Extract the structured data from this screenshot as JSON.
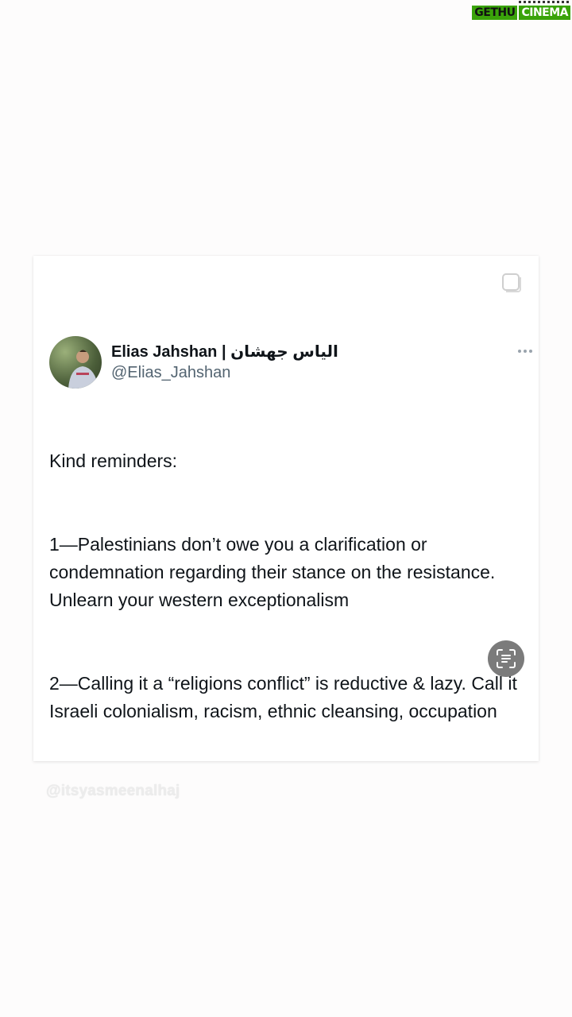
{
  "logo": {
    "part1": "GETHU",
    "part2": "CINEMA"
  },
  "tweet": {
    "author_name": "Elias Jahshan | الياس جهشان",
    "author_handle": "@Elias_Jahshan",
    "paragraphs": [
      "Kind reminders:",
      "1—Palestinians don’t owe you a clarification or condemnation regarding their stance on the resistance. Unlearn your western exceptionalism",
      "2—Calling it a “religions conflict” is reductive & lazy. Call it Israeli colonialism, racism, ethnic cleansing, occupation"
    ]
  },
  "watermark": "@itsyasmeenalhaj",
  "icons": {
    "copy": "copy-icon",
    "more": "more-options-icon",
    "scan": "text-scan-icon"
  },
  "colors": {
    "logo_green": "#3aa30a",
    "handle_gray": "#536471",
    "scan_button": "#7b7b7b"
  }
}
